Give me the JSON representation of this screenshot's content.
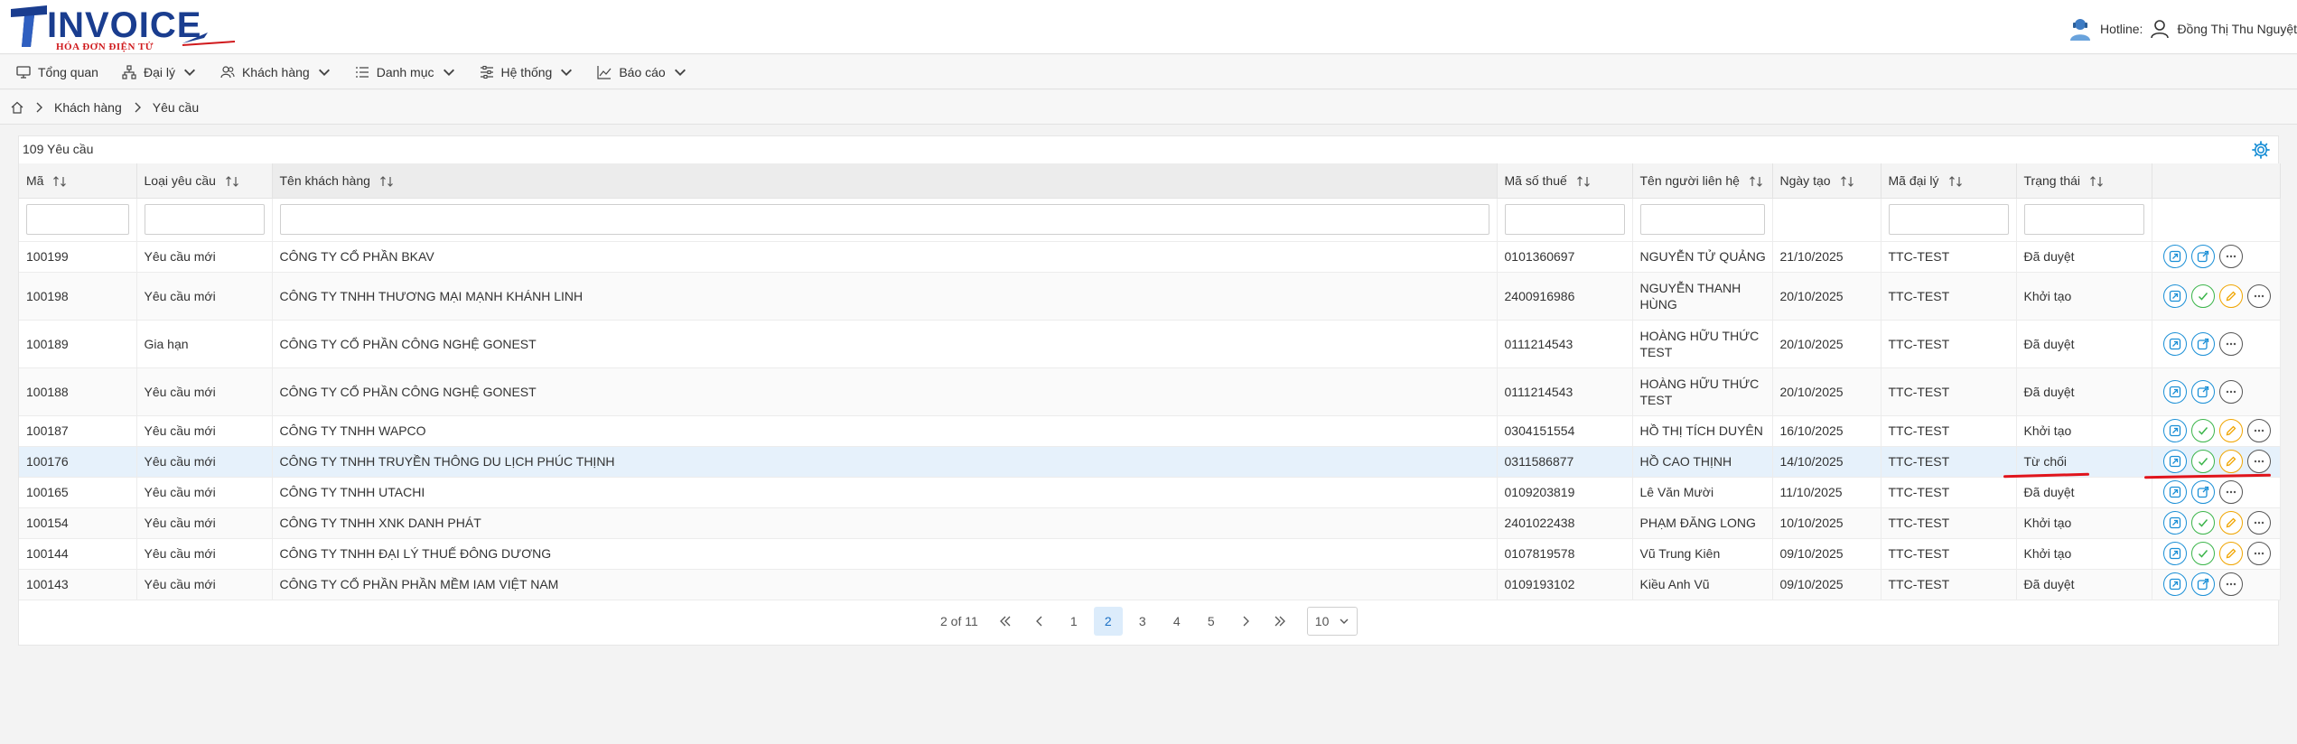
{
  "brand": {
    "name": "INVOICE",
    "tagline": "HÓA ĐƠN ĐIỆN TỬ"
  },
  "header": {
    "hotline_label": "Hotline:",
    "user_name": "Đồng Thị Thu Nguyệt"
  },
  "nav": [
    {
      "label": "Tổng quan",
      "icon": "monitor-icon",
      "dropdown": false
    },
    {
      "label": "Đại lý",
      "icon": "sitemap-icon",
      "dropdown": true
    },
    {
      "label": "Khách hàng",
      "icon": "users-icon",
      "dropdown": true
    },
    {
      "label": "Danh mục",
      "icon": "list-icon",
      "dropdown": true
    },
    {
      "label": "Hệ thống",
      "icon": "sliders-icon",
      "dropdown": true
    },
    {
      "label": "Báo cáo",
      "icon": "chart-icon",
      "dropdown": true
    }
  ],
  "breadcrumb": {
    "items": [
      "Khách hàng",
      "Yêu cầu"
    ]
  },
  "table": {
    "title": "109 Yêu cầu",
    "columns": [
      "Mã",
      "Loại yêu cầu",
      "Tên khách hàng",
      "Mã số thuế",
      "Tên người liên hệ",
      "Ngày tạo",
      "Mã đại lý",
      "Trạng thái"
    ],
    "rows": [
      {
        "ma": "100199",
        "loai": "Yêu cầu mới",
        "ten": "CÔNG TY CỔ PHẦN BKAV",
        "mst": "0101360697",
        "lienhe": "NGUYỄN TỬ QUẢNG",
        "ngay": "21/10/2025",
        "daily": "TTC-TEST",
        "trangthai": "Đã duyệt",
        "actions": [
          "view",
          "edit",
          "more"
        ]
      },
      {
        "ma": "100198",
        "loai": "Yêu cầu mới",
        "ten": "CÔNG TY TNHH THƯƠNG MẠI MẠNH KHÁNH LINH",
        "mst": "2400916986",
        "lienhe": "NGUYỄN THANH HÙNG",
        "ngay": "20/10/2025",
        "daily": "TTC-TEST",
        "trangthai": "Khởi tạo",
        "actions": [
          "view",
          "approve",
          "pencil",
          "more"
        ]
      },
      {
        "ma": "100189",
        "loai": "Gia hạn",
        "ten": "CÔNG TY CỔ PHẦN CÔNG NGHỆ GONEST",
        "mst": "0111214543",
        "lienhe": "HOÀNG HỮU THỨC TEST",
        "ngay": "20/10/2025",
        "daily": "TTC-TEST",
        "trangthai": "Đã duyệt",
        "actions": [
          "view",
          "edit",
          "more"
        ]
      },
      {
        "ma": "100188",
        "loai": "Yêu cầu mới",
        "ten": "CÔNG TY CỔ PHẦN CÔNG NGHỆ GONEST",
        "mst": "0111214543",
        "lienhe": "HOÀNG HỮU THỨC TEST",
        "ngay": "20/10/2025",
        "daily": "TTC-TEST",
        "trangthai": "Đã duyệt",
        "actions": [
          "view",
          "edit",
          "more"
        ]
      },
      {
        "ma": "100187",
        "loai": "Yêu cầu mới",
        "ten": "CÔNG TY TNHH WAPCO",
        "mst": "0304151554",
        "lienhe": "HỒ THỊ TÍCH DUYÊN",
        "ngay": "16/10/2025",
        "daily": "TTC-TEST",
        "trangthai": "Khởi tạo",
        "actions": [
          "view",
          "approve",
          "pencil",
          "more"
        ]
      },
      {
        "ma": "100176",
        "loai": "Yêu cầu mới",
        "ten": "CÔNG TY TNHH TRUYỀN THÔNG DU LỊCH PHÚC THỊNH",
        "mst": "0311586877",
        "lienhe": "HỒ CAO THỊNH",
        "ngay": "14/10/2025",
        "daily": "TTC-TEST",
        "trangthai": "Từ chối",
        "actions": [
          "view",
          "approve",
          "pencil",
          "more"
        ]
      },
      {
        "ma": "100165",
        "loai": "Yêu cầu mới",
        "ten": "CÔNG TY TNHH UTACHI",
        "mst": "0109203819",
        "lienhe": "Lê Văn Mười",
        "ngay": "11/10/2025",
        "daily": "TTC-TEST",
        "trangthai": "Đã duyệt",
        "actions": [
          "view",
          "edit",
          "more"
        ]
      },
      {
        "ma": "100154",
        "loai": "Yêu cầu mới",
        "ten": "CÔNG TY TNHH XNK DANH PHÁT",
        "mst": "2401022438",
        "lienhe": "PHẠM ĐĂNG LONG",
        "ngay": "10/10/2025",
        "daily": "TTC-TEST",
        "trangthai": "Khởi tạo",
        "actions": [
          "view",
          "approve",
          "pencil",
          "more"
        ]
      },
      {
        "ma": "100144",
        "loai": "Yêu cầu mới",
        "ten": "CÔNG TY TNHH ĐẠI LÝ THUẾ ĐÔNG DƯƠNG",
        "mst": "0107819578",
        "lienhe": "Vũ Trung Kiên",
        "ngay": "09/10/2025",
        "daily": "TTC-TEST",
        "trangthai": "Khởi tạo",
        "actions": [
          "view",
          "approve",
          "pencil",
          "more"
        ]
      },
      {
        "ma": "100143",
        "loai": "Yêu cầu mới",
        "ten": "CÔNG TY CỔ PHẦN PHẦN MỀM IAM VIỆT NAM",
        "mst": "0109193102",
        "lienhe": "Kiều Anh Vũ",
        "ngay": "09/10/2025",
        "daily": "TTC-TEST",
        "trangthai": "Đã duyệt",
        "actions": [
          "view",
          "edit",
          "more"
        ]
      }
    ]
  },
  "pagination": {
    "info": "2 of 11",
    "pages": [
      "1",
      "2",
      "3",
      "4",
      "5"
    ],
    "current": "2",
    "page_size": "10"
  },
  "colors": {
    "accent_blue": "#1a8fd6",
    "approve_green": "#3bb54a",
    "pencil_orange": "#f0a500",
    "brand_blue": "#1a3d8f",
    "brand_red": "#d0191c",
    "annotation_red": "#e0141c"
  }
}
